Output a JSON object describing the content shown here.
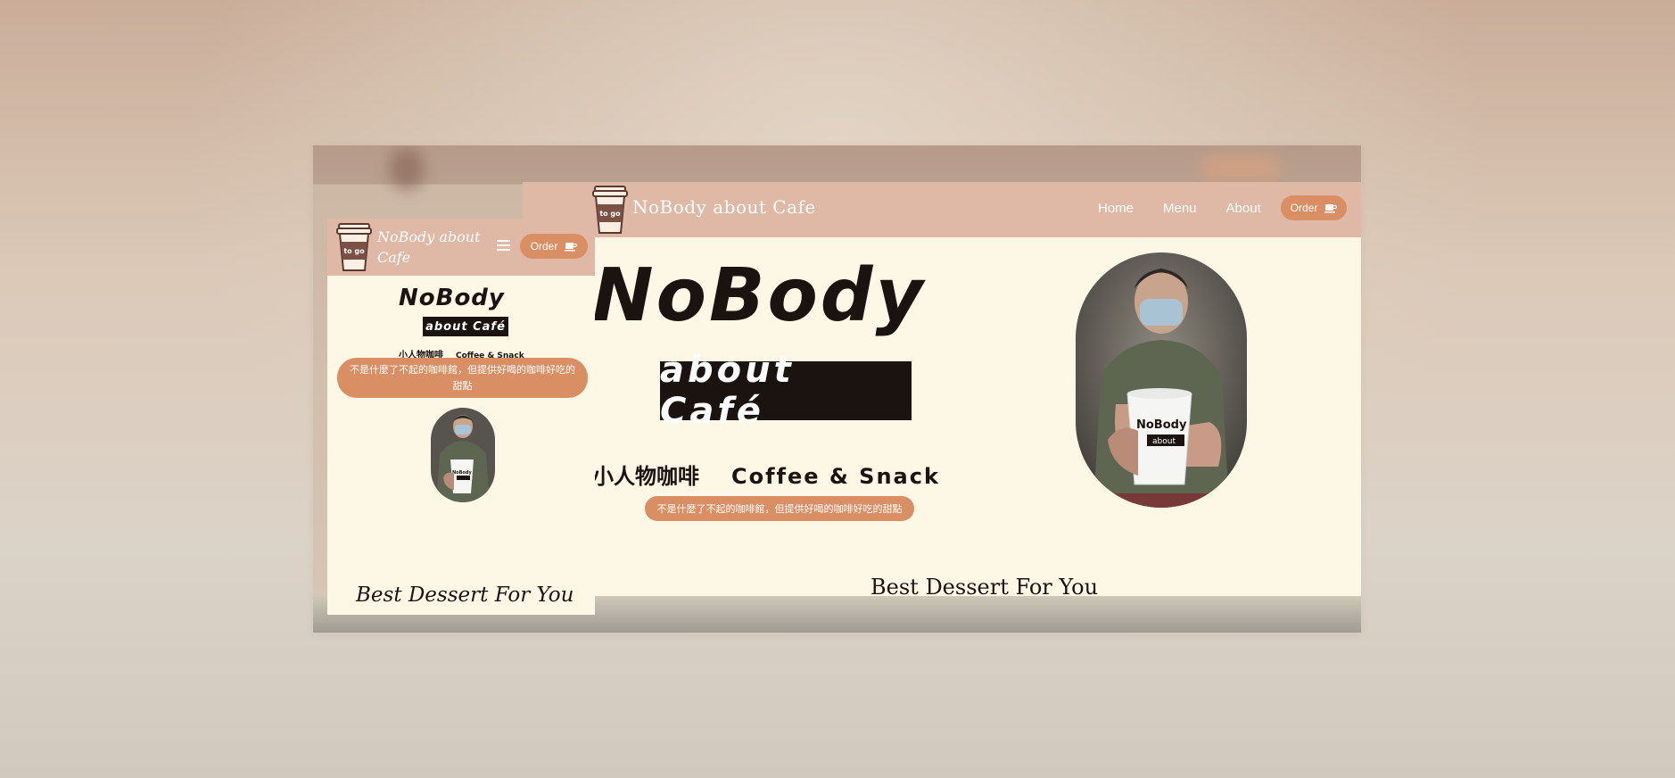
{
  "desktop": {
    "brand": "NoBody about Cafe",
    "logo_text": "to go",
    "nav": [
      "Home",
      "Menu",
      "About"
    ],
    "order_label": "Order",
    "hero_title": "NoBody",
    "hero_about": "about  Café",
    "sub_zh": "小人物咖啡",
    "sub_en": "Coffee & Snack",
    "tagline": "不是什麼了不起的咖啡館，但提供好喝的咖啡好吃的甜點",
    "section_title_a": "Best ",
    "section_title_b": "Dessert",
    "section_title_c": " For You",
    "cup_text_1": "NoBody",
    "cup_text_2": "about"
  },
  "mobile": {
    "brand": "NoBody about Cafe",
    "logo_text": "to go",
    "order_label": "Order",
    "hero_title": "NoBody",
    "hero_about": "about  Café",
    "sub_zh": "小人物咖啡",
    "sub_en": "Coffee & Snack",
    "tagline": "不是什麼了不起的咖啡館，但提供好喝的咖啡好吃的甜點",
    "section_title": "Best Dessert For You",
    "cup_text": "NoBody"
  },
  "colors": {
    "nav_bg": "#dfb9a5",
    "accent": "#d98e63",
    "page_bg": "#fdf7e6",
    "ink": "#1a1310"
  },
  "icons": [
    "coffee-cup-logo-icon",
    "coffee-cup-icon",
    "hamburger-menu-icon"
  ]
}
